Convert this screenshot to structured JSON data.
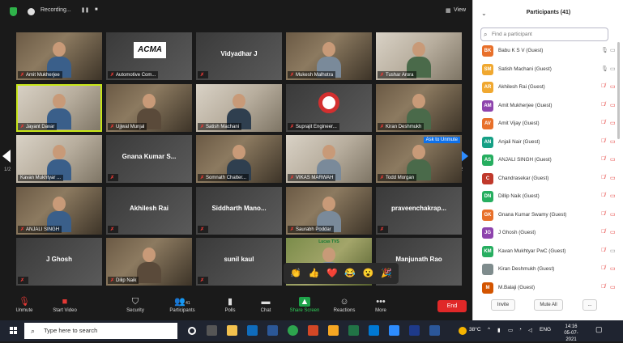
{
  "topbar": {
    "recording_label": "Recording...",
    "pause_label": "❚❚",
    "stop_label": "■",
    "view_label": "View"
  },
  "tiles": [
    {
      "kind": "video",
      "name": "Amit Mukherjee",
      "muted": true
    },
    {
      "kind": "logo-acma",
      "name": "Automotive Com...",
      "muted": true,
      "logo_text": "ACMA"
    },
    {
      "kind": "name",
      "name": "",
      "display": "Vidyadhar J",
      "muted": true
    },
    {
      "kind": "video",
      "name": "Mukesh Malhotra",
      "muted": true
    },
    {
      "kind": "video",
      "name": "Tushar Arora",
      "muted": true
    },
    {
      "kind": "video-active",
      "name": "Jayant Davar",
      "muted": true
    },
    {
      "kind": "video",
      "name": "Ujjwal Munjal",
      "muted": true
    },
    {
      "kind": "video",
      "name": "Satish Machani",
      "muted": true
    },
    {
      "kind": "logo-suprajit",
      "name": "Suprajit Engineer...",
      "muted": true
    },
    {
      "kind": "video",
      "name": "Kiran Deshmukh",
      "muted": true
    },
    {
      "kind": "video",
      "name": "Kavan Mukhtyar ...",
      "muted": false
    },
    {
      "kind": "name",
      "name": "",
      "display": "Gnana Kumar S...",
      "muted": true
    },
    {
      "kind": "video",
      "name": "Somnath Chatter...",
      "muted": true
    },
    {
      "kind": "video",
      "name": "VIKAS MARWAH",
      "muted": true
    },
    {
      "kind": "video",
      "name": "Todd Morgan",
      "muted": true,
      "tag": "Ask to Unmute"
    },
    {
      "kind": "video",
      "name": "ANJALI SINGH",
      "muted": true
    },
    {
      "kind": "name",
      "name": "",
      "display": "Akhilesh Rai",
      "muted": true
    },
    {
      "kind": "name",
      "name": "",
      "display": "Siddharth Mano...",
      "muted": true
    },
    {
      "kind": "video",
      "name": "Saurabh Poddar",
      "muted": true
    },
    {
      "kind": "name",
      "name": "",
      "display": "praveenchakrap...",
      "muted": true
    },
    {
      "kind": "name",
      "name": "",
      "display": "J Ghosh",
      "muted": true
    },
    {
      "kind": "video",
      "name": "Dilip Naik",
      "muted": true
    },
    {
      "kind": "name",
      "name": "",
      "display": "sunil kaul",
      "muted": true
    },
    {
      "kind": "video-green",
      "name": "",
      "muted": true,
      "banner": "Lucas TVS"
    },
    {
      "kind": "name",
      "name": "",
      "display": "Manjunath Rao",
      "muted": true
    }
  ],
  "page_indicator_left": "1/2",
  "page_indicator_right": "1/2",
  "reactions": [
    "👏",
    "👍",
    "❤️",
    "😂",
    "😮",
    "🎉"
  ],
  "toolbar": {
    "unmute": "Unmute",
    "start_video": "Start Video",
    "security": "Security",
    "participants": "Participants",
    "participants_count": "41",
    "polls": "Polls",
    "chat": "Chat",
    "share_screen": "Share Screen",
    "reactions": "Reactions",
    "more": "More",
    "end": "End"
  },
  "panel": {
    "title": "Participants (41)",
    "search_placeholder": "Find a participant",
    "participants": [
      {
        "initials": "BK",
        "name": "Babu K S V (Guest)",
        "color": "#e8702a",
        "mic_muted": false,
        "cam_muted": false
      },
      {
        "initials": "SM",
        "name": "Satish Machani (Guest)",
        "color": "#f0a830",
        "mic_muted": false,
        "cam_muted": false
      },
      {
        "initials": "AR",
        "name": "Akhilesh Rai (Guest)",
        "color": "#f0a830",
        "mic_muted": true,
        "cam_muted": true
      },
      {
        "initials": "AM",
        "name": "Amit Mukherjee (Guest)",
        "color": "#8e44ad",
        "mic_muted": true,
        "cam_muted": true
      },
      {
        "initials": "AV",
        "name": "Amit Vijay (Guest)",
        "color": "#e8702a",
        "mic_muted": true,
        "cam_muted": true
      },
      {
        "initials": "AN",
        "name": "Anjali Nair (Guest)",
        "color": "#16a085",
        "mic_muted": true,
        "cam_muted": true
      },
      {
        "initials": "AS",
        "name": "ANJALI SINGH (Guest)",
        "color": "#27ae60",
        "mic_muted": true,
        "cam_muted": true
      },
      {
        "initials": "C",
        "name": "Chandrasekar (Guest)",
        "color": "#c0392b",
        "mic_muted": true,
        "cam_muted": true
      },
      {
        "initials": "DN",
        "name": "Dillip Naik (Guest)",
        "color": "#27ae60",
        "mic_muted": true,
        "cam_muted": true
      },
      {
        "initials": "GK",
        "name": "Gnana Kumar Swamy (Guest)",
        "color": "#e8702a",
        "mic_muted": true,
        "cam_muted": true
      },
      {
        "initials": "JG",
        "name": "J Ghosh (Guest)",
        "color": "#8e44ad",
        "mic_muted": true,
        "cam_muted": true
      },
      {
        "initials": "KM",
        "name": "Kavan Mukhtyar PwC (Guest)",
        "color": "#27ae60",
        "mic_muted": true,
        "cam_muted": false
      },
      {
        "initials": "",
        "name": "Kiran Deshmukh (Guest)",
        "color": "#7f8c8d",
        "mic_muted": true,
        "cam_muted": true
      },
      {
        "initials": "M",
        "name": "M.Balaji (Guest)",
        "color": "#d35400",
        "mic_muted": true,
        "cam_muted": true
      }
    ],
    "invite": "Invite",
    "mute_all": "Mute All",
    "more": "..."
  },
  "taskbar": {
    "search_placeholder": "Type here to search",
    "temperature": "38°C",
    "language": "ENG",
    "time": "14:16",
    "date": "05-07-2021"
  }
}
